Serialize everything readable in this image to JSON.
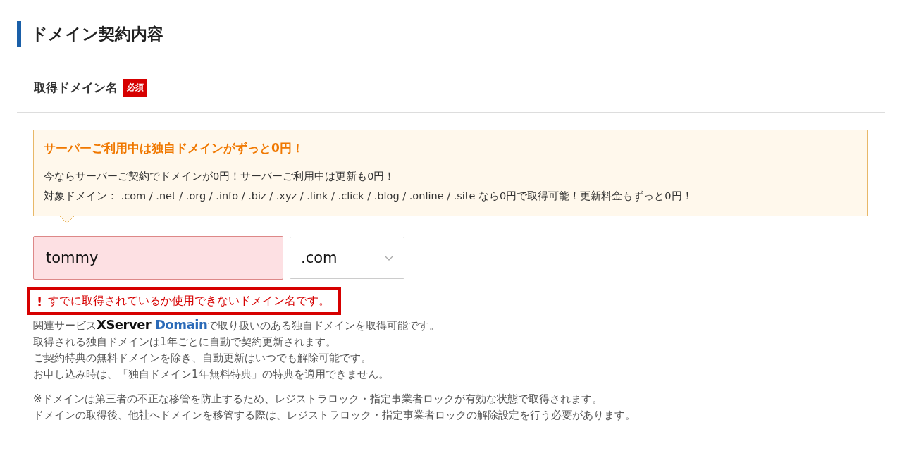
{
  "section_title": "ドメイン契約内容",
  "field": {
    "label": "取得ドメイン名",
    "required_badge": "必須"
  },
  "notice": {
    "title": "サーバーご利用中は独自ドメインがずっと0円！",
    "lines": [
      "今ならサーバーご契約でドメインが0円！サーバーご利用中は更新も0円！",
      "対象ドメイン： .com / .net / .org / .info / .biz / .xyz / .link / .click / .blog / .online / .site なら0円で取得可能！更新料金もずっと0円！"
    ]
  },
  "domain_input": {
    "value": "tommy",
    "invalid": true
  },
  "tld_select": {
    "value": ".com"
  },
  "error": {
    "icon": "!",
    "message": "すでに取得されているか使用できないドメイン名です。",
    "highlighted": true
  },
  "service_line": {
    "prefix": "関連サービス",
    "logo_main": "XServer",
    "logo_sub": "Domain",
    "suffix": "で取り扱いのある独自ドメインを取得可能です。"
  },
  "notes": [
    "取得される独自ドメインは1年ごとに自動で契約更新されます。",
    "ご契約特典の無料ドメインを除き、自動更新はいつでも解除可能です。",
    "お申し込み時は、「独自ドメイン1年無料特典」の特典を適用できません。"
  ],
  "footnotes": [
    "※ドメインは第三者の不正な移管を防止するため、レジストラロック・指定事業者ロックが有効な状態で取得されます。",
    "ドメインの取得後、他社へドメインを移管する際は、レジストラロック・指定事業者ロックの解除設定を行う必要があります。"
  ]
}
